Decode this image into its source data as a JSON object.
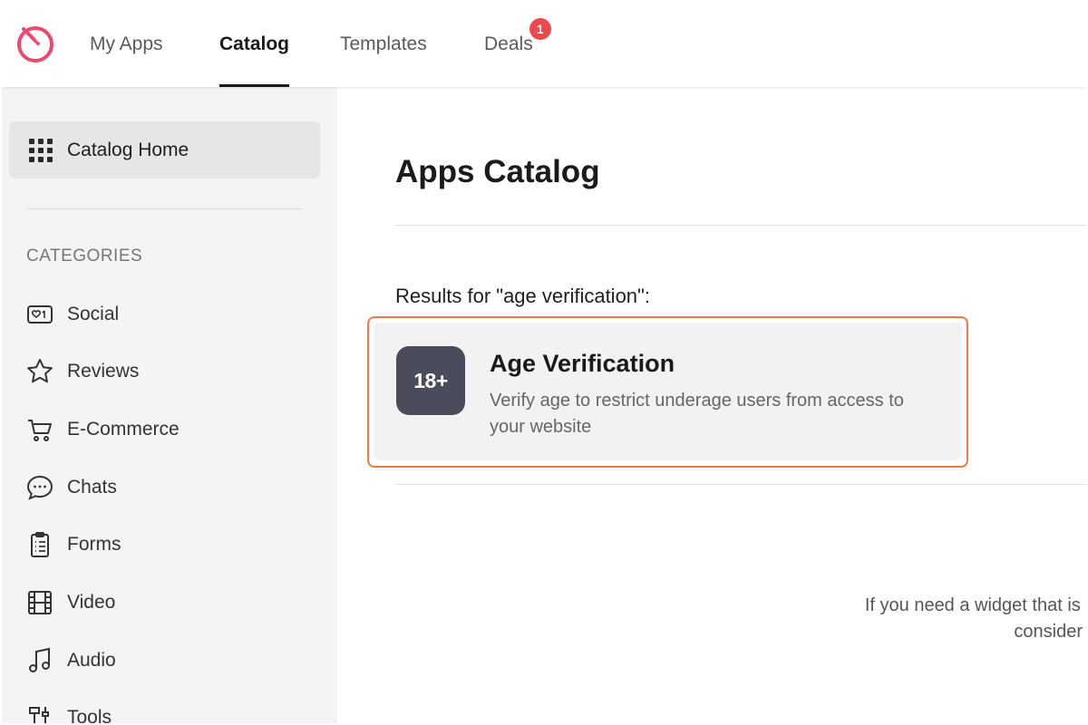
{
  "nav": {
    "tabs": [
      {
        "label": "My Apps",
        "active": false
      },
      {
        "label": "Catalog",
        "active": true
      },
      {
        "label": "Templates",
        "active": false
      },
      {
        "label": "Deals",
        "active": false,
        "badge": "1"
      }
    ],
    "brand_color": "#f0476c"
  },
  "sidebar": {
    "home_label": "Catalog Home",
    "categories_title": "CATEGORIES",
    "categories": [
      {
        "label": "Social",
        "icon": "social-icon"
      },
      {
        "label": "Reviews",
        "icon": "star-icon"
      },
      {
        "label": "E-Commerce",
        "icon": "cart-icon"
      },
      {
        "label": "Chats",
        "icon": "chat-icon"
      },
      {
        "label": "Forms",
        "icon": "clipboard-icon"
      },
      {
        "label": "Video",
        "icon": "film-icon"
      },
      {
        "label": "Audio",
        "icon": "music-note-icon"
      },
      {
        "label": "Tools",
        "icon": "tools-icon"
      }
    ]
  },
  "main": {
    "title": "Apps Catalog",
    "results_label": "Results for \"age verification\":",
    "result": {
      "icon_text": "18+",
      "name": "Age Verification",
      "description": "Verify age to restrict underage users from access to your website"
    },
    "footer_line1": "If you need a widget that is r",
    "footer_line2": "consider"
  },
  "colors": {
    "highlight": "#f07a3f",
    "badge": "#f0474f",
    "app_icon_bg": "#4a4c5b"
  }
}
